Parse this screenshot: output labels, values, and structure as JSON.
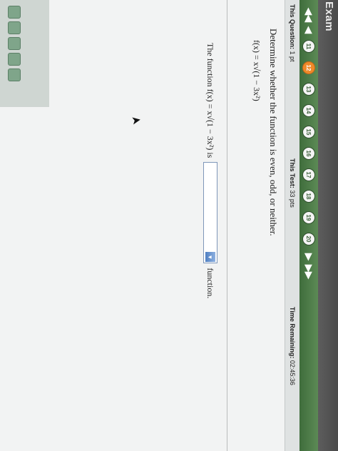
{
  "window": {
    "title": "Exam"
  },
  "nav": {
    "first_label": "◀◀",
    "prev_label": "◀",
    "next_label": "▶",
    "last_label": "▶▶",
    "current": "12",
    "questions": [
      "11",
      "12",
      "13",
      "14",
      "15",
      "16",
      "17",
      "18",
      "19",
      "20"
    ]
  },
  "info": {
    "question_label": "This Question:",
    "question_value": "1 pt",
    "test_label": "This Test:",
    "test_value": "33 pts",
    "time_label": "Time Remaining:",
    "time_value": "02:45:36"
  },
  "question": {
    "prompt": "Determine whether the function is even, odd, or neither.",
    "expression": "f(x) = x√(1 − 3x²)",
    "answer_prefix": "The function f(x) = x√(1 − 3x²) is",
    "answer_value": "",
    "answer_suffix": "function."
  },
  "colors": {
    "nav_green": "#4a7a46",
    "current_question": "#f08a2a",
    "dropdown_blue": "#4f7fc2"
  }
}
